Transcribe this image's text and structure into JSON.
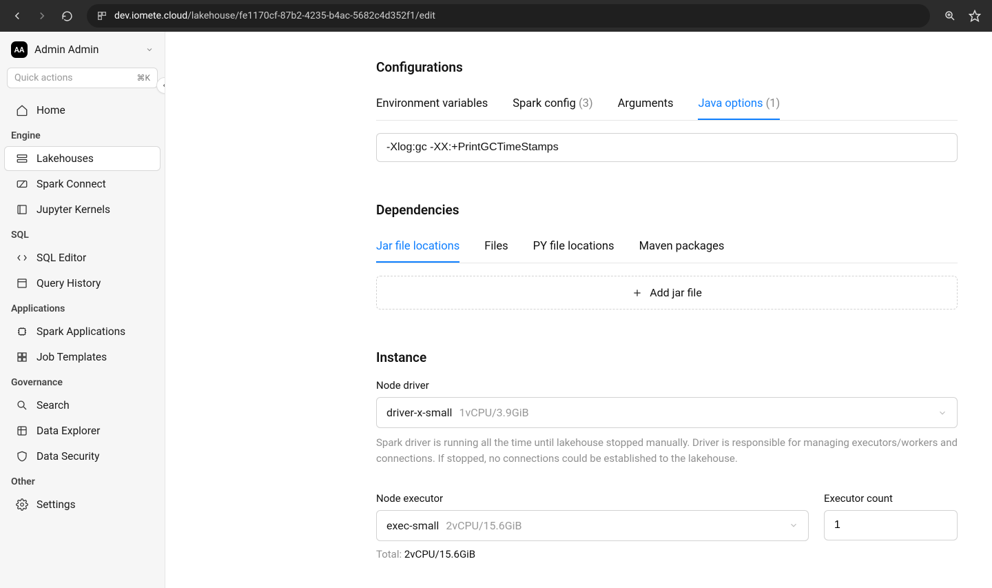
{
  "browser": {
    "url_domain": "dev.iomete.cloud",
    "url_path": "/lakehouse/fe1170cf-87b2-4235-b4ac-5682c4d352f1/edit"
  },
  "sidebar": {
    "avatar": "AA",
    "user_name": "Admin Admin",
    "quick_actions_placeholder": "Quick actions",
    "quick_actions_kbd": "⌘K",
    "groups": {
      "home": "Home",
      "engine": "Engine",
      "sql": "SQL",
      "applications": "Applications",
      "governance": "Governance",
      "other": "Other"
    },
    "items": {
      "lakehouses": "Lakehouses",
      "spark_connect": "Spark Connect",
      "jupyter_kernels": "Jupyter Kernels",
      "sql_editor": "SQL Editor",
      "query_history": "Query History",
      "spark_applications": "Spark Applications",
      "job_templates": "Job Templates",
      "search": "Search",
      "data_explorer": "Data Explorer",
      "data_security": "Data Security",
      "settings": "Settings"
    }
  },
  "configurations": {
    "heading": "Configurations",
    "tabs": {
      "env": "Environment variables",
      "spark": "Spark config",
      "spark_count": "(3)",
      "args": "Arguments",
      "java": "Java options",
      "java_count": "(1)"
    },
    "java_options_value": "-Xlog:gc -XX:+PrintGCTimeStamps"
  },
  "dependencies": {
    "heading": "Dependencies",
    "tabs": {
      "jar": "Jar file locations",
      "files": "Files",
      "py": "PY file locations",
      "maven": "Maven packages"
    },
    "add_jar_label": "Add jar file"
  },
  "instance": {
    "heading": "Instance",
    "driver_label": "Node driver",
    "driver_value": "driver-x-small",
    "driver_spec": "1vCPU/3.9GiB",
    "driver_help": "Spark driver is running all the time until lakehouse stopped manually. Driver is responsible for managing executors/workers and connections. If stopped, no connections could be established to the lakehouse.",
    "executor_label": "Node executor",
    "executor_value": "exec-small",
    "executor_spec": "2vCPU/15.6GiB",
    "executor_count_label": "Executor count",
    "executor_count_value": "1",
    "total_label": "Total: ",
    "total_spec": "2vCPU/15.6GiB"
  }
}
